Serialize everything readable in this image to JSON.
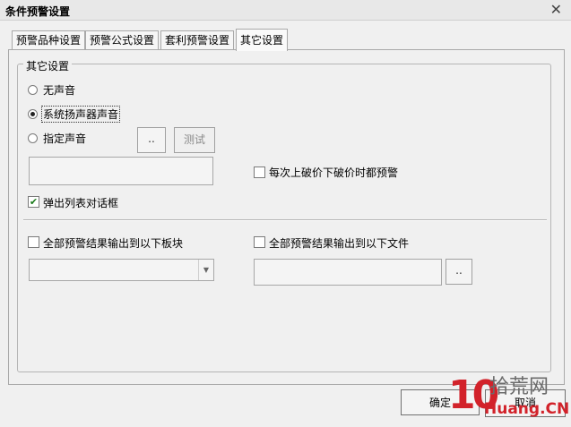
{
  "window": {
    "title": "条件预警设置"
  },
  "tabs": [
    {
      "label": "预警品种设置",
      "active": false
    },
    {
      "label": "预警公式设置",
      "active": false
    },
    {
      "label": "套利预警设置",
      "active": false
    },
    {
      "label": "其它设置",
      "active": true
    }
  ],
  "group": {
    "legend": "其它设置",
    "sound_options": [
      {
        "label": "无声音",
        "checked": false
      },
      {
        "label": "系统扬声器声音",
        "checked": true
      },
      {
        "label": "指定声音",
        "checked": false
      }
    ],
    "browse_label": "..",
    "test_label": "测试",
    "sound_path_value": "",
    "alert_every_break_label": "每次上破价下破价时都预警",
    "alert_every_break_checked": false,
    "popup_list_label": "弹出列表对话框",
    "popup_list_checked": true,
    "export_block_label": "全部预警结果输出到以下板块",
    "export_block_checked": false,
    "block_select_value": "",
    "export_file_label": "全部预警结果输出到以下文件",
    "export_file_checked": false,
    "file_path_value": "",
    "file_browse_label": ".."
  },
  "footer": {
    "ok_label": "确定",
    "cancel_label": "取消"
  },
  "watermark": {
    "number": "10",
    "cn": "拾荒网",
    "site": "Huang.CN"
  }
}
